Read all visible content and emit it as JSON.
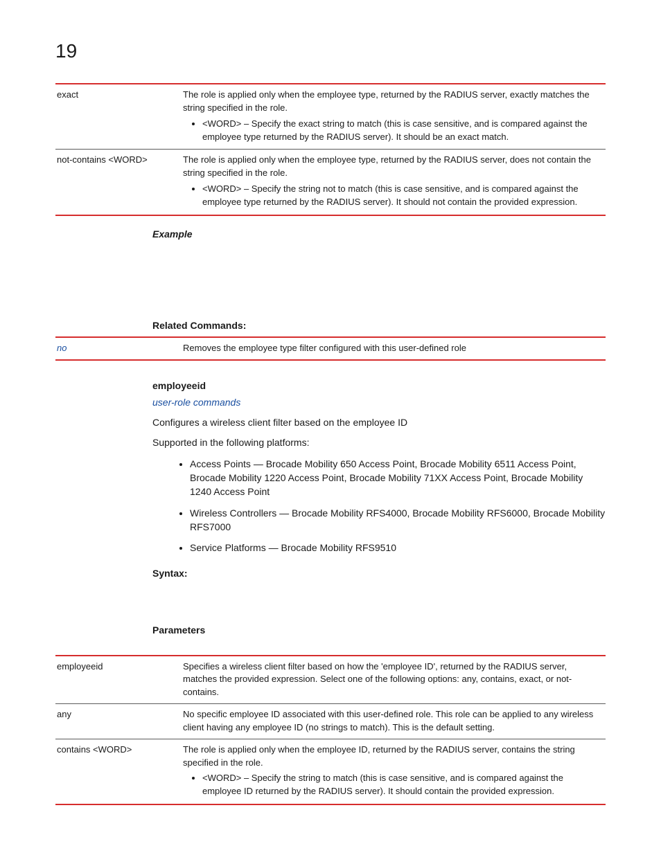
{
  "page_number": "19",
  "table1": {
    "rows": [
      {
        "key": "exact",
        "desc": "The role is applied only when the employee type, returned by the RADIUS server, exactly matches the string specified in the role.",
        "bullet": "<WORD> – Specify the exact string to match (this is case sensitive, and is compared against the employee type returned by the RADIUS server). It should be an exact match."
      },
      {
        "key": "not-contains <WORD>",
        "desc": "The role is applied only when the employee type, returned by the RADIUS server, does not contain the string specified in the role.",
        "bullet": "<WORD> – Specify the string not to match (this is case sensitive, and is compared against the employee type returned by the RADIUS server). It should not contain the provided expression."
      }
    ]
  },
  "labels": {
    "example": "Example",
    "related_commands": "Related Commands:",
    "syntax": "Syntax:",
    "parameters": "Parameters"
  },
  "related_table": {
    "key": "no",
    "desc": "Removes the employee type filter configured with this user-defined role"
  },
  "section": {
    "title": "employeeid",
    "link": "user-role commands",
    "intro": "Configures a wireless client filter based on the employee ID",
    "supported_line": "Supported in the following platforms:",
    "platforms": [
      "Access Points — Brocade Mobility 650 Access Point, Brocade Mobility 6511 Access Point, Brocade Mobility 1220 Access Point, Brocade Mobility 71XX Access Point, Brocade Mobility 1240 Access Point",
      "Wireless Controllers — Brocade Mobility RFS4000, Brocade Mobility RFS6000, Brocade Mobility RFS7000",
      "Service Platforms — Brocade Mobility RFS9510"
    ]
  },
  "table2": {
    "rows": [
      {
        "key": "employeeid",
        "desc": "Specifies a wireless client filter based on how the 'employee ID', returned by the RADIUS server, matches the provided expression. Select one of the following options: any, contains, exact, or not-contains."
      },
      {
        "key": "any",
        "desc": "No specific employee ID associated with this user-defined role. This role can be applied to any wireless client having any employee ID (no strings to match). This is the default setting."
      },
      {
        "key": "contains <WORD>",
        "desc": "The role is applied only when the employee ID, returned by the RADIUS server, contains the string specified in the role.",
        "bullet": "<WORD> – Specify the string to match (this is case sensitive, and is compared against the employee ID returned by the RADIUS server). It should contain the provided expression."
      }
    ]
  }
}
